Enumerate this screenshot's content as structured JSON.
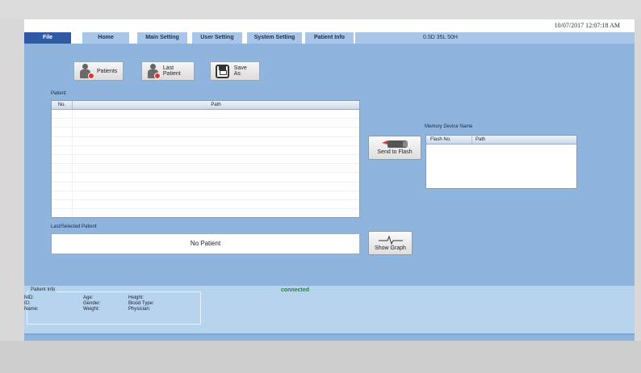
{
  "header": {
    "datetime": "10/07/2017 12:07:18 AM"
  },
  "tabs": [
    {
      "label": "File",
      "active": true
    },
    {
      "label": "Home"
    },
    {
      "label": "Main Setting"
    },
    {
      "label": "User Setting"
    },
    {
      "label": "System Setting"
    },
    {
      "label": "Patient Info"
    }
  ],
  "settings_info": "0.5D  35L  50H",
  "toolbar": {
    "patients_label": "Patients",
    "last_patient_label": "Last Patient",
    "save_as_label": "Save As"
  },
  "patient_table": {
    "group_label": "Patient",
    "columns": [
      "No.",
      "Path"
    ]
  },
  "send_to_flash_label": "Send to Flash",
  "memory_device": {
    "group_label": "Memory Device Name",
    "columns": [
      "Flash No.",
      "Path"
    ]
  },
  "last_selected": {
    "group_label": "Last/Selected Patient",
    "value": "No Patient"
  },
  "show_graph_label": "Show Graph",
  "status": {
    "connection": "connected"
  },
  "patient_info": {
    "title": "Patient Info",
    "col1": [
      "NID:",
      "ID:",
      "Name:"
    ],
    "col2": [
      "Age:",
      "Gender:",
      "Weight:"
    ],
    "col3": [
      "Height:",
      "Blood Type:",
      "Physician:"
    ]
  },
  "colors": {
    "app_bg": "#8fb4dd",
    "active_tab": "#2f5aa6",
    "connected": "#1d8a2b"
  },
  "icons": [
    "patients-icon",
    "last-patient-icon",
    "save-icon",
    "flash-drive-icon",
    "waveform-icon"
  ]
}
